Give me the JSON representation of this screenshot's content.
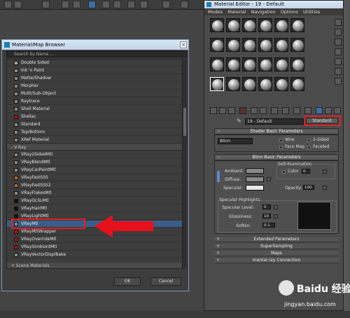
{
  "browser": {
    "title": "Material/Map Browser",
    "search_placeholder": "Search by Name ...",
    "items_top": [
      {
        "label": "Double Sided",
        "color": "#aaaaaa"
      },
      {
        "label": "Ink 'n Paint",
        "color": "#8c8c8c"
      },
      {
        "label": "Matte/Shadow",
        "color": "#8c8c8c"
      },
      {
        "label": "Morpher",
        "color": "#8c8c8c"
      },
      {
        "label": "Multi/Sub-Object",
        "color": "#8c8c8c"
      },
      {
        "label": "Raytrace",
        "color": "#8c8c8c"
      },
      {
        "label": "Shell Material",
        "color": "#8c8c8c"
      },
      {
        "label": "Shellac",
        "color": "#b01515"
      },
      {
        "label": "Standard",
        "color": "#8c8c8c"
      },
      {
        "label": "Top/Bottom",
        "color": "#8c8c8c"
      },
      {
        "label": "XRef Material",
        "color": "#8c8c8c"
      }
    ],
    "group_vray": "- V-Ray",
    "items_vray": [
      {
        "label": "VRay2SidedMtl",
        "color": "#8c8c8c"
      },
      {
        "label": "VRayBlendMtl",
        "color": "#8c8c8c"
      },
      {
        "label": "VRayCarPaintMtl",
        "color": "#8c8c8c"
      },
      {
        "label": "VRayFastSSS",
        "color": "#c06a30"
      },
      {
        "label": "VRayFastSSS2",
        "color": "#c06a30"
      },
      {
        "label": "VRayFlakesMtl",
        "color": "#8c8c8c"
      },
      {
        "label": "VRayGLSLMtl",
        "color": "#111111"
      },
      {
        "label": "VRayHairMtl",
        "color": "#111111"
      },
      {
        "label": "VRayLightMtl",
        "color": "#111111"
      },
      {
        "label": "VRayMtl",
        "color": "#8c8c8c"
      },
      {
        "label": "VRayMtlWrapper",
        "color": "#b01515"
      },
      {
        "label": "VRayOverrideMtl",
        "color": "#b01515"
      },
      {
        "label": "VRaySimbiontMtl",
        "color": "#b01515"
      },
      {
        "label": "VRayVectorDisplBake",
        "color": "#8c8c8c"
      }
    ],
    "group_scene": "+ Scene Materials",
    "ok_label": "OK",
    "cancel_label": "Cancel"
  },
  "editor": {
    "title": "Material Editor - 19 - Default",
    "menu": [
      "Modes",
      "Material",
      "Navigation",
      "Options",
      "Utilities"
    ],
    "material_name": "19 - Default",
    "material_type": "Standard",
    "shader_header": "Shader Basic Parameters",
    "shader_value": "Blinn",
    "opt_wire": "Wire",
    "opt_2sided": "2-Sided",
    "opt_facemap": "Face Map",
    "opt_faceted": "Faceted",
    "blinn_header": "Blinn Basic Parameters",
    "self_illum_label": "Self-Illumination",
    "color_label": "Color",
    "color_value": "0",
    "ambient_label": "Ambient:",
    "diffuse_label": "Diffuse:",
    "specular_label": "Specular:",
    "opacity_label": "Opacity:",
    "opacity_value": "100",
    "spec_highlights_label": "Specular Highlights",
    "spec_level_label": "Specular Level:",
    "spec_level_value": "0",
    "glossiness_label": "Glossiness:",
    "glossiness_value": "10",
    "soften_label": "Soften:",
    "soften_value": "0.1",
    "rollouts": [
      "Extended Parameters",
      "SuperSampling",
      "Maps",
      "mental ray Connection"
    ]
  },
  "watermark": {
    "brand": "Baidu 经验",
    "url": "jingyan.baidu.com"
  }
}
